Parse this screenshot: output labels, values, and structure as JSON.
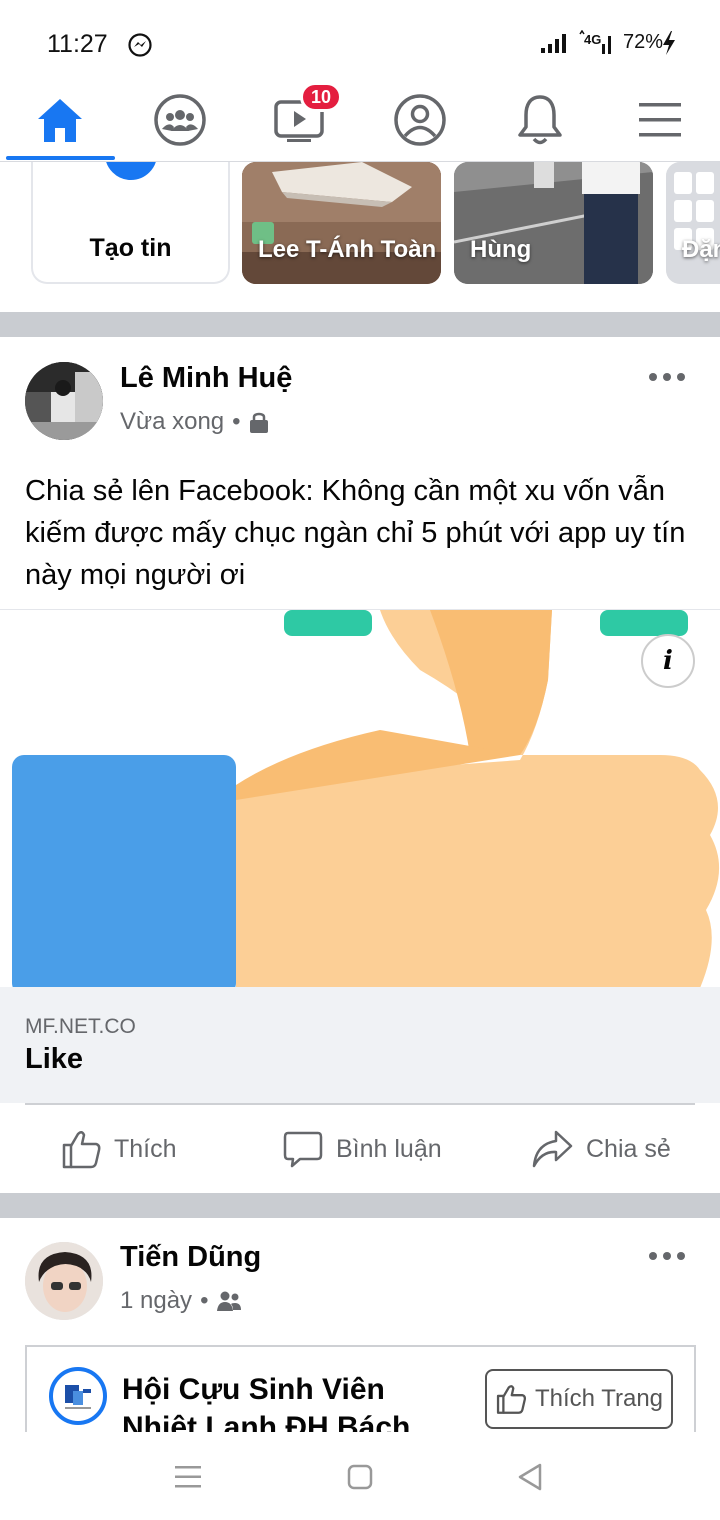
{
  "status_bar": {
    "time": "11:27",
    "network": "4G",
    "battery": "72%"
  },
  "top_nav": {
    "items": [
      {
        "icon": "home-icon",
        "active": true
      },
      {
        "icon": "groups-icon"
      },
      {
        "icon": "watch-icon",
        "badge": "10"
      },
      {
        "icon": "profile-icon"
      },
      {
        "icon": "notifications-icon"
      },
      {
        "icon": "menu-icon"
      }
    ],
    "accent": "#1877f2"
  },
  "stories": [
    {
      "label": "Tạo tin",
      "type": "create"
    },
    {
      "label": "Lee T-Ánh Toàn"
    },
    {
      "label": "Hùng"
    },
    {
      "label": "Đặn"
    }
  ],
  "post1": {
    "author": "Lê Minh Huệ",
    "time": "Vừa xong",
    "privacy_icon": "lock-icon",
    "text": "Chia sẻ lên Facebook: Không cần một xu vốn vẫn kiếm được mấy chục ngàn chỉ 5 phút với app uy tín này mọi người ơi",
    "link_domain": "MF.NET.CO",
    "link_title": "Like",
    "info_label": "i"
  },
  "actions": {
    "like": "Thích",
    "comment": "Bình luận",
    "share": "Chia sẻ"
  },
  "post2": {
    "author": "Tiến Dũng",
    "time": "1 ngày",
    "privacy_icon": "friends-icon",
    "page_name": "Hội Cựu Sinh Viên Nhiệt Lạnh ĐH Bách",
    "like_page": "Thích Trang"
  },
  "colors": {
    "brand": "#1877f2",
    "badge": "#e41e3f",
    "divider": "#c9ccd1"
  }
}
